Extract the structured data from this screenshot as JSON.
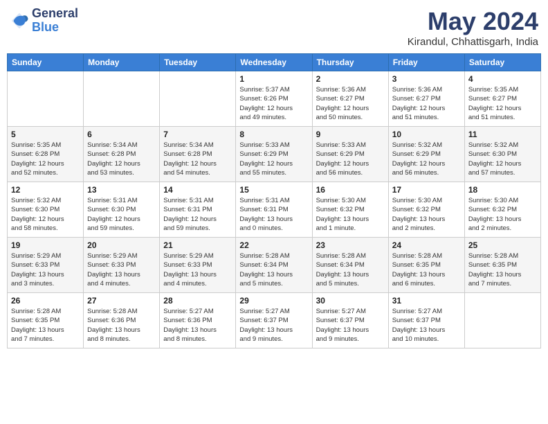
{
  "header": {
    "logo_line1": "General",
    "logo_line2": "Blue",
    "month_title": "May 2024",
    "subtitle": "Kirandul, Chhattisgarh, India"
  },
  "weekdays": [
    "Sunday",
    "Monday",
    "Tuesday",
    "Wednesday",
    "Thursday",
    "Friday",
    "Saturday"
  ],
  "weeks": [
    [
      {
        "day": "",
        "info": ""
      },
      {
        "day": "",
        "info": ""
      },
      {
        "day": "",
        "info": ""
      },
      {
        "day": "1",
        "info": "Sunrise: 5:37 AM\nSunset: 6:26 PM\nDaylight: 12 hours\nand 49 minutes."
      },
      {
        "day": "2",
        "info": "Sunrise: 5:36 AM\nSunset: 6:27 PM\nDaylight: 12 hours\nand 50 minutes."
      },
      {
        "day": "3",
        "info": "Sunrise: 5:36 AM\nSunset: 6:27 PM\nDaylight: 12 hours\nand 51 minutes."
      },
      {
        "day": "4",
        "info": "Sunrise: 5:35 AM\nSunset: 6:27 PM\nDaylight: 12 hours\nand 51 minutes."
      }
    ],
    [
      {
        "day": "5",
        "info": "Sunrise: 5:35 AM\nSunset: 6:28 PM\nDaylight: 12 hours\nand 52 minutes."
      },
      {
        "day": "6",
        "info": "Sunrise: 5:34 AM\nSunset: 6:28 PM\nDaylight: 12 hours\nand 53 minutes."
      },
      {
        "day": "7",
        "info": "Sunrise: 5:34 AM\nSunset: 6:28 PM\nDaylight: 12 hours\nand 54 minutes."
      },
      {
        "day": "8",
        "info": "Sunrise: 5:33 AM\nSunset: 6:29 PM\nDaylight: 12 hours\nand 55 minutes."
      },
      {
        "day": "9",
        "info": "Sunrise: 5:33 AM\nSunset: 6:29 PM\nDaylight: 12 hours\nand 56 minutes."
      },
      {
        "day": "10",
        "info": "Sunrise: 5:32 AM\nSunset: 6:29 PM\nDaylight: 12 hours\nand 56 minutes."
      },
      {
        "day": "11",
        "info": "Sunrise: 5:32 AM\nSunset: 6:30 PM\nDaylight: 12 hours\nand 57 minutes."
      }
    ],
    [
      {
        "day": "12",
        "info": "Sunrise: 5:32 AM\nSunset: 6:30 PM\nDaylight: 12 hours\nand 58 minutes."
      },
      {
        "day": "13",
        "info": "Sunrise: 5:31 AM\nSunset: 6:30 PM\nDaylight: 12 hours\nand 59 minutes."
      },
      {
        "day": "14",
        "info": "Sunrise: 5:31 AM\nSunset: 6:31 PM\nDaylight: 12 hours\nand 59 minutes."
      },
      {
        "day": "15",
        "info": "Sunrise: 5:31 AM\nSunset: 6:31 PM\nDaylight: 13 hours\nand 0 minutes."
      },
      {
        "day": "16",
        "info": "Sunrise: 5:30 AM\nSunset: 6:32 PM\nDaylight: 13 hours\nand 1 minute."
      },
      {
        "day": "17",
        "info": "Sunrise: 5:30 AM\nSunset: 6:32 PM\nDaylight: 13 hours\nand 2 minutes."
      },
      {
        "day": "18",
        "info": "Sunrise: 5:30 AM\nSunset: 6:32 PM\nDaylight: 13 hours\nand 2 minutes."
      }
    ],
    [
      {
        "day": "19",
        "info": "Sunrise: 5:29 AM\nSunset: 6:33 PM\nDaylight: 13 hours\nand 3 minutes."
      },
      {
        "day": "20",
        "info": "Sunrise: 5:29 AM\nSunset: 6:33 PM\nDaylight: 13 hours\nand 4 minutes."
      },
      {
        "day": "21",
        "info": "Sunrise: 5:29 AM\nSunset: 6:33 PM\nDaylight: 13 hours\nand 4 minutes."
      },
      {
        "day": "22",
        "info": "Sunrise: 5:28 AM\nSunset: 6:34 PM\nDaylight: 13 hours\nand 5 minutes."
      },
      {
        "day": "23",
        "info": "Sunrise: 5:28 AM\nSunset: 6:34 PM\nDaylight: 13 hours\nand 5 minutes."
      },
      {
        "day": "24",
        "info": "Sunrise: 5:28 AM\nSunset: 6:35 PM\nDaylight: 13 hours\nand 6 minutes."
      },
      {
        "day": "25",
        "info": "Sunrise: 5:28 AM\nSunset: 6:35 PM\nDaylight: 13 hours\nand 7 minutes."
      }
    ],
    [
      {
        "day": "26",
        "info": "Sunrise: 5:28 AM\nSunset: 6:35 PM\nDaylight: 13 hours\nand 7 minutes."
      },
      {
        "day": "27",
        "info": "Sunrise: 5:28 AM\nSunset: 6:36 PM\nDaylight: 13 hours\nand 8 minutes."
      },
      {
        "day": "28",
        "info": "Sunrise: 5:27 AM\nSunset: 6:36 PM\nDaylight: 13 hours\nand 8 minutes."
      },
      {
        "day": "29",
        "info": "Sunrise: 5:27 AM\nSunset: 6:37 PM\nDaylight: 13 hours\nand 9 minutes."
      },
      {
        "day": "30",
        "info": "Sunrise: 5:27 AM\nSunset: 6:37 PM\nDaylight: 13 hours\nand 9 minutes."
      },
      {
        "day": "31",
        "info": "Sunrise: 5:27 AM\nSunset: 6:37 PM\nDaylight: 13 hours\nand 10 minutes."
      },
      {
        "day": "",
        "info": ""
      }
    ]
  ]
}
